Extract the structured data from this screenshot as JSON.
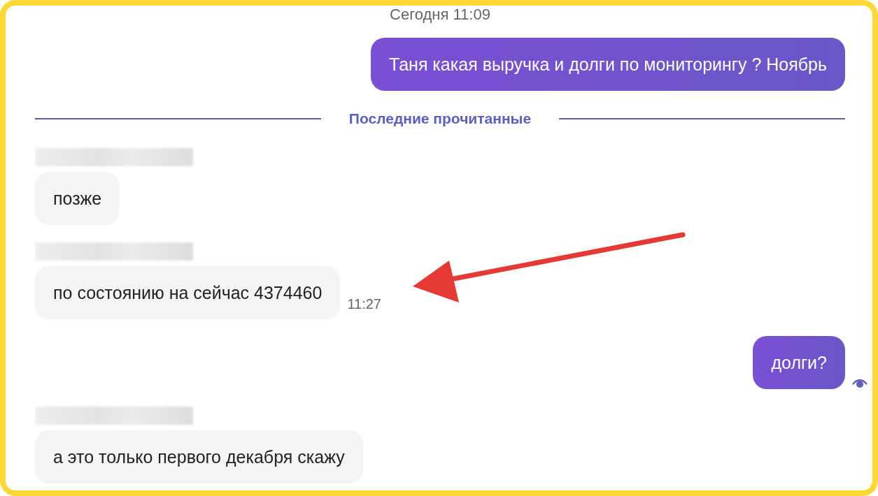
{
  "chat": {
    "items": [
      {
        "kind": "date",
        "text": "Сегодня 11:09"
      },
      {
        "kind": "outgoing",
        "text": "Таня какая выручка и долги по мониторингу ? Ноябрь",
        "seen": false
      },
      {
        "kind": "divider",
        "text": "Последние прочитанные"
      },
      {
        "kind": "incoming",
        "text": "позже"
      },
      {
        "kind": "incoming",
        "text": "по состоянию на сейчас 4374460",
        "time": "11:27"
      },
      {
        "kind": "outgoing",
        "text": "долги?",
        "seen": true
      },
      {
        "kind": "incoming",
        "text": "а это только первого декабря скажу"
      }
    ]
  }
}
